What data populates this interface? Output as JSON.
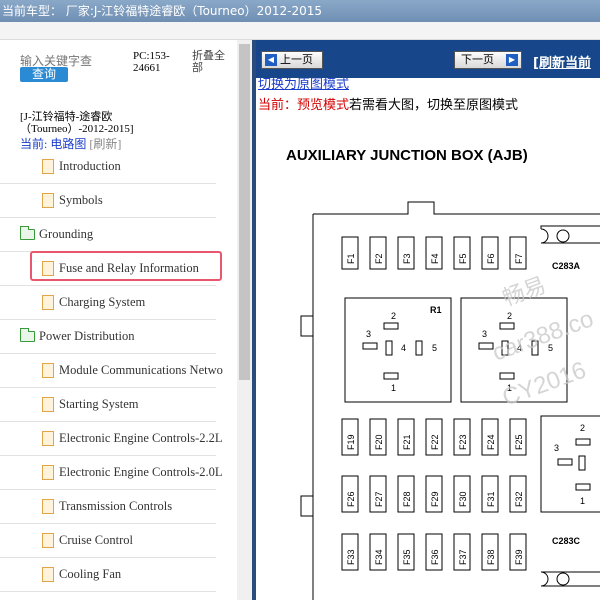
{
  "window": {
    "title": "当前车型：  厂家:J-江铃福特途睿欧（Tourneo）2012-2015"
  },
  "sidebar": {
    "search_placeholder": "输入关键字查",
    "search_button": "查询",
    "pc_code": "PC:153-24661",
    "collapse_all": "折叠全部",
    "book_title": "[J-江铃福特-途睿欧（Tourneo）-2012-2015]",
    "current_label": "当前: 电路图",
    "refresh_label": "[刷新]",
    "items": [
      {
        "label": "Introduction",
        "type": "doc"
      },
      {
        "label": "Symbols",
        "type": "doc"
      },
      {
        "label": "Grounding",
        "type": "folder"
      },
      {
        "label": "Fuse and Relay Information",
        "type": "doc",
        "selected": true
      },
      {
        "label": "Charging System",
        "type": "doc"
      },
      {
        "label": "Power Distribution",
        "type": "folder"
      },
      {
        "label": "Module Communications Netwo",
        "type": "doc"
      },
      {
        "label": "Starting System",
        "type": "doc"
      },
      {
        "label": "Electronic Engine Controls-2.2L",
        "type": "doc"
      },
      {
        "label": "Electronic Engine Controls-2.0L",
        "type": "doc"
      },
      {
        "label": "Transmission Controls",
        "type": "doc"
      },
      {
        "label": "Cruise Control",
        "type": "doc"
      },
      {
        "label": "Cooling Fan",
        "type": "doc"
      }
    ]
  },
  "viewer": {
    "prev_button": "上一页",
    "next_button": "下一页",
    "refresh_link": "[刷新当前",
    "switch_link": "切换为原图模式",
    "preview_prefix": "当前：预览模式",
    "preview_hint": "若需看大图，切换至原图模式"
  },
  "diagram": {
    "title": "AUXILIARY JUNCTION BOX (AJB)",
    "fuses_top": [
      "F1",
      "F2",
      "F3",
      "F4",
      "F5",
      "F6",
      "F7"
    ],
    "fuses_mid": [
      "F19",
      "F20",
      "F21",
      "F22",
      "F23",
      "F24",
      "F25"
    ],
    "fuses_low": [
      "F26",
      "F27",
      "F28",
      "F29",
      "F30",
      "F31",
      "F32"
    ],
    "fuses_bottom": [
      "F33",
      "F34",
      "F35",
      "F36",
      "F37",
      "F38",
      "F39"
    ],
    "connector_top": "C283A",
    "connector_bottom": "C283C",
    "relay_label": "R1",
    "relay_pins": [
      "1",
      "2",
      "3",
      "4",
      "5"
    ],
    "watermark": [
      "畅易",
      "car388.co",
      "CY2016"
    ]
  },
  "colors": {
    "nav_blue": "#17478a",
    "search_button": "#2a8ad4",
    "highlight_border": "#e8576e",
    "preview_red": "#d40000",
    "link_blue": "#1a3cc8"
  }
}
